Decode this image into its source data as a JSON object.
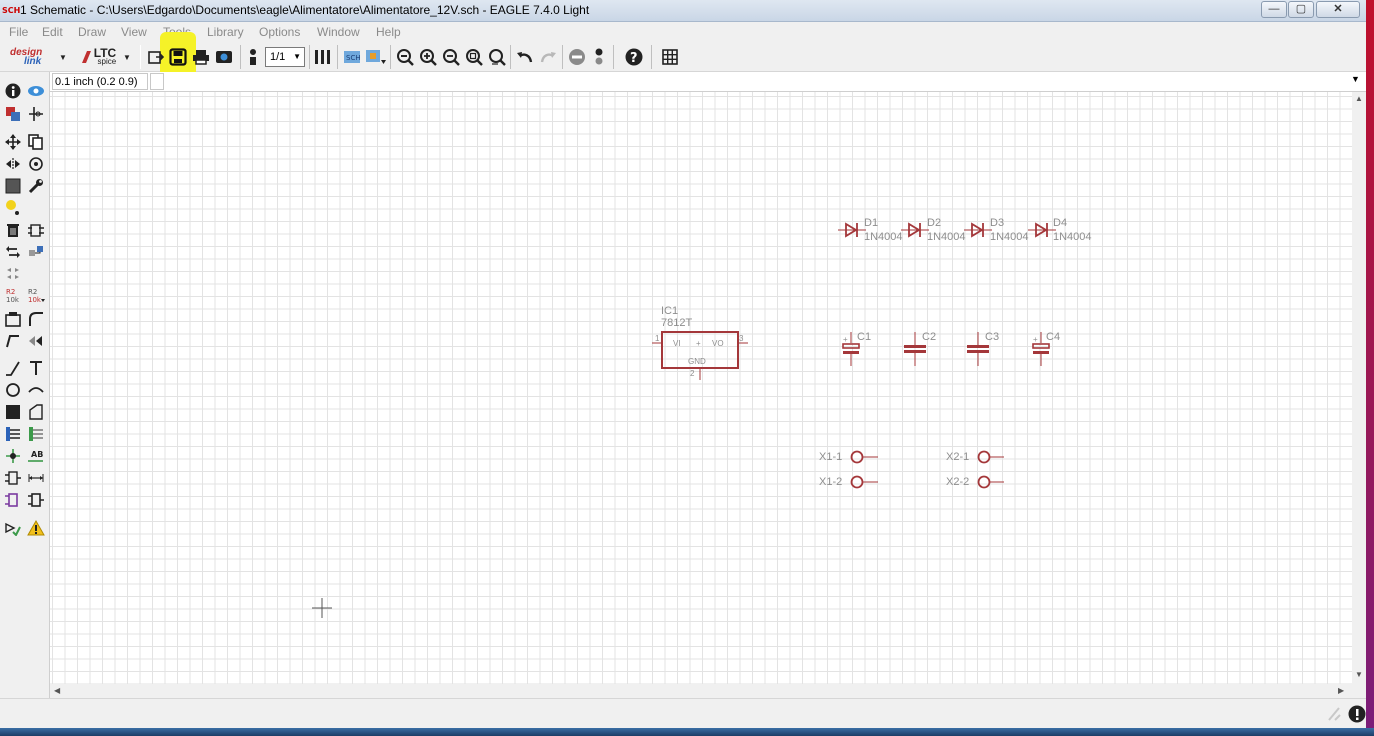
{
  "titlebar": {
    "app_icon_text": "SCH",
    "title": "1 Schematic - C:\\Users\\Edgardo\\Documents\\eagle\\Alimentatore\\Alimentatore_12V.sch - EAGLE 7.4.0 Light",
    "minimize": "—",
    "maximize": "▢",
    "close": "✕"
  },
  "menu": [
    "File",
    "Edit",
    "Draw",
    "View",
    "Tools",
    "Library",
    "Options",
    "Window",
    "Help"
  ],
  "toolbar": {
    "design_link_top": "design",
    "design_link_bottom": "link",
    "ltc_top": "LTC",
    "ltc_bottom": "spice",
    "sheet_value": "1/1",
    "highlight_color": "#f5f228"
  },
  "coord": {
    "value": "0.1 inch (0.2 0.9)"
  },
  "schematic": {
    "colors": {
      "symbol": "#a4373a",
      "label": "#8e8e8e"
    },
    "ic": {
      "name": "IC1",
      "value": "7812T",
      "pin_vi": "VI",
      "pin_vo": "VO",
      "pin_gnd": "GND",
      "pin_plus": "+",
      "pin1": "1",
      "pin2": "2",
      "pin3": "3"
    },
    "diodes": [
      {
        "name": "D1",
        "value": "1N4004"
      },
      {
        "name": "D2",
        "value": "1N4004"
      },
      {
        "name": "D3",
        "value": "1N4004"
      },
      {
        "name": "D4",
        "value": "1N4004"
      }
    ],
    "capacitors": [
      {
        "name": "C1",
        "polarized": true
      },
      {
        "name": "C2",
        "polarized": false
      },
      {
        "name": "C3",
        "polarized": false
      },
      {
        "name": "C4",
        "polarized": true
      }
    ],
    "cap_plus": "+",
    "connectors": [
      "X1-1",
      "X1-2",
      "X2-1",
      "X2-2"
    ]
  }
}
